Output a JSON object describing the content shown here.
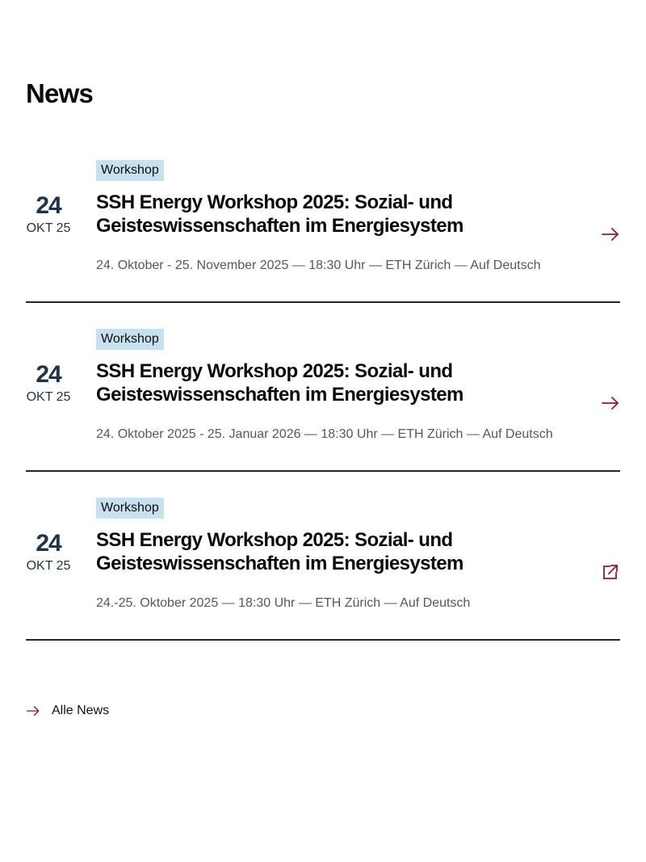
{
  "page": {
    "title": "News"
  },
  "news": [
    {
      "day": "24",
      "month": "OKT 25",
      "badge": "Workshop",
      "title_line1": "SSH Energy Workshop 2025: Sozial- und",
      "title_line2": "Geisteswissenschaften im Energiesystem",
      "meta": "24. Oktober - 25. November 2025 — 18:30 Uhr — ETH Zürich — Auf Deutsch",
      "link_icon": "arrow-right-icon"
    },
    {
      "day": "24",
      "month": "OKT 25",
      "badge": "Workshop",
      "title_line1": "SSH Energy Workshop 2025: Sozial- und",
      "title_line2": "Geisteswissenschaften im Energiesystem",
      "meta": "24. Oktober 2025 - 25. Januar 2026 — 18:30 Uhr — ETH Zürich — Auf Deutsch",
      "link_icon": "arrow-right-icon"
    },
    {
      "day": "24",
      "month": "OKT 25",
      "badge": "Workshop",
      "title_line1": "SSH Energy Workshop 2025: Sozial- und",
      "title_line2": "Geisteswissenschaften im Energiesystem",
      "meta": "24.-25. Oktober 2025 — 18:30 Uhr — ETH Zürich — Auf Deutsch",
      "link_icon": "external-link-icon"
    }
  ],
  "footer": {
    "all_news_label": "Alle News",
    "all_news_icon": "arrow-right-icon"
  },
  "colors": {
    "accent": "#8a1e2c",
    "badge_bg": "#c7e1ef",
    "date_text": "#1f3446",
    "divider": "#1b2a36",
    "meta_text": "#4f5a63"
  }
}
